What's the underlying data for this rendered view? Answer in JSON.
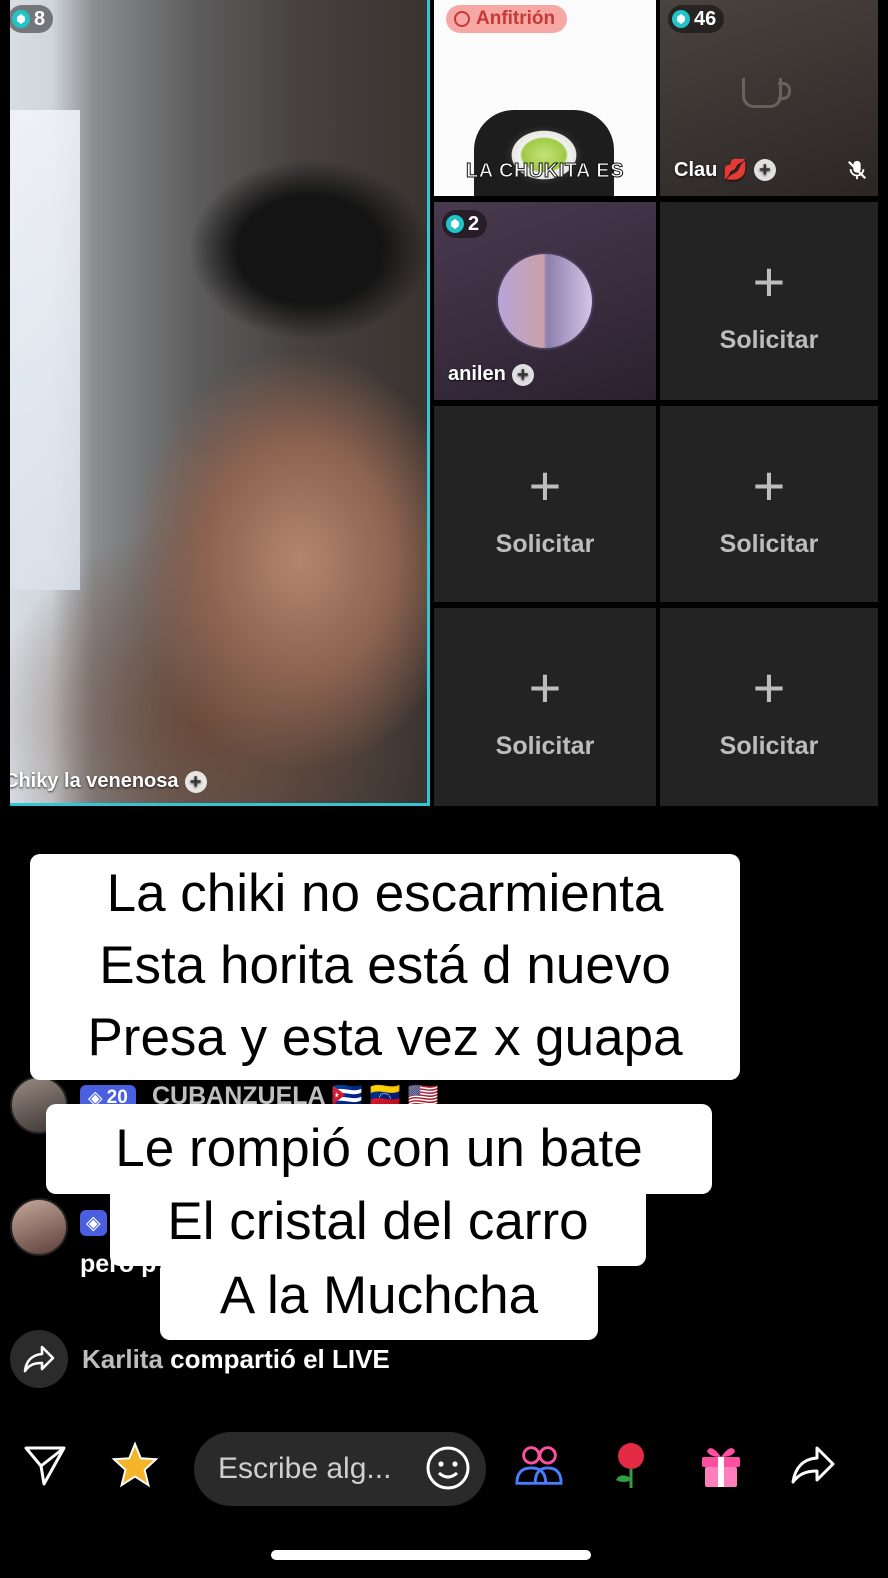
{
  "streams": {
    "main": {
      "count": "8",
      "name": "Chiky la venenosa"
    },
    "host": {
      "role": "Anfitrión",
      "caption": "LA CHUKITA ES"
    },
    "guest1": {
      "count": "46",
      "name": "Clau 💋"
    },
    "guest2": {
      "count": "2",
      "name": "anilen"
    },
    "empty_label": "Solicitar",
    "empty_slots": 5
  },
  "captions": {
    "block1": [
      "La chiki no escarmienta",
      "Esta horita está d nuevo",
      "Presa y esta vez x guapa"
    ],
    "block2_line1": "Le rompió con un bate",
    "block2_line2": "El cristal del carro",
    "block2_line3": "A la Muchcha"
  },
  "chat": {
    "msg1": {
      "level": "20",
      "name": "CUBANZUELA 🇨🇺 🇻🇪 🇺🇸"
    },
    "msg2": {
      "text": "pero p"
    },
    "share": {
      "user": "Karlita",
      "action": "compartió el LIVE"
    }
  },
  "bottom_bar": {
    "comment_placeholder": "Escribe alg...",
    "icons": [
      "send-icon",
      "star-icon",
      "emoji-icon",
      "guests-icon",
      "rose-gift-icon",
      "gift-icon",
      "share-icon"
    ]
  },
  "colors": {
    "accent": "#2fc6d6",
    "host_pill": "#f7a8a5",
    "level_badge": "#4a5ee0",
    "gift_pink": "#ff4fa0"
  }
}
